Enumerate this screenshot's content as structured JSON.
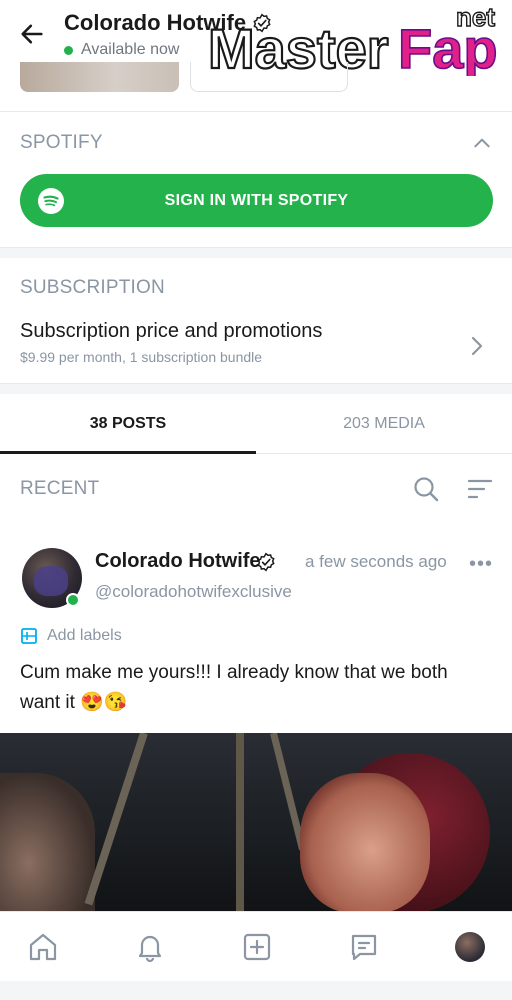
{
  "header": {
    "title": "Colorado Hotwife",
    "status": "Available now"
  },
  "watermark": {
    "text_main": "MasterFap",
    "text_sup": "net"
  },
  "spotify": {
    "section_label": "SPOTIFY",
    "button_label": "SIGN IN WITH SPOTIFY",
    "expanded": true
  },
  "subscription": {
    "section_label": "SUBSCRIPTION",
    "title": "Subscription price and promotions",
    "detail": "$9.99 per month, 1 subscription bundle"
  },
  "tabs": [
    {
      "label": "38 POSTS",
      "active": true
    },
    {
      "label": "203 MEDIA",
      "active": false
    }
  ],
  "recent": {
    "label": "RECENT"
  },
  "post": {
    "author": "Colorado Hotwife",
    "handle": "@coloradohotwifexclusive",
    "time": "a few seconds ago",
    "more": "•••",
    "labels_action": "Add labels",
    "text": "Cum make me yours!!! I already know that we both want it 😍😘"
  },
  "colors": {
    "accent_green": "#23b24b",
    "muted": "#8a96a3",
    "label_blue": "#00aff0"
  },
  "nav": {
    "items": [
      "home-icon",
      "bell-icon",
      "plus-square-icon",
      "message-icon",
      "profile-avatar"
    ]
  }
}
